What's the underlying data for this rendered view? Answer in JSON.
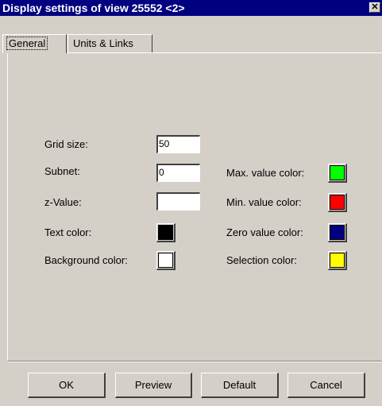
{
  "window": {
    "title": "Display settings of view 25552 <2>"
  },
  "tabs": [
    {
      "label": "General",
      "selected": true
    },
    {
      "label": "Units & Links",
      "selected": false
    }
  ],
  "general": {
    "grid_size": {
      "label": "Grid size:",
      "value": "50"
    },
    "subnet": {
      "label": "Subnet:",
      "value": "0"
    },
    "z_value": {
      "label": "z-Value:",
      "value": ""
    },
    "text_color": {
      "label": "Text color:",
      "color": "#000000"
    },
    "background_color": {
      "label": "Background color:",
      "color": "#ffffff"
    },
    "max_value_color": {
      "label": "Max. value color:",
      "color": "#00ff00"
    },
    "min_value_color": {
      "label": "Min. value color:",
      "color": "#ff0000"
    },
    "zero_value_color": {
      "label": "Zero value color:",
      "color": "#000080"
    },
    "selection_color": {
      "label": "Selection color:",
      "color": "#ffff00"
    }
  },
  "buttons": {
    "ok": "OK",
    "preview": "Preview",
    "default": "Default",
    "cancel": "Cancel"
  },
  "icons": {
    "close": "close-icon"
  }
}
